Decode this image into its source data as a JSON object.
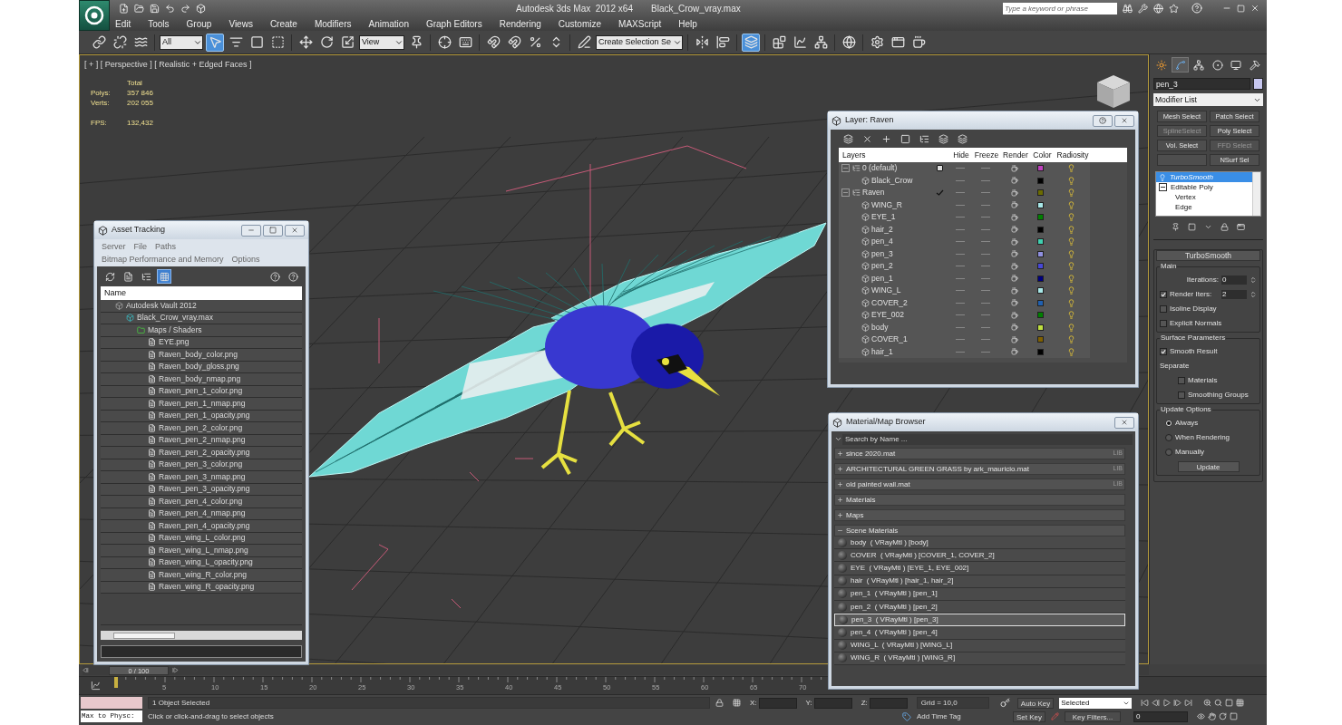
{
  "app": {
    "title": "Autodesk 3ds Max  2012 x64",
    "file": "Black_Crow_vray.max",
    "search": {
      "placeholder": "Type a keyword or phrase"
    }
  },
  "menu": [
    "Edit",
    "Tools",
    "Group",
    "Views",
    "Create",
    "Modifiers",
    "Animation",
    "Graph Editors",
    "Rendering",
    "Customize",
    "MAXScript",
    "Help"
  ],
  "toolbar": {
    "selection_filter": "All",
    "reference_coord": "View",
    "named_selection": "Create Selection Se",
    "buttons": [
      {
        "selected": false
      },
      {
        "selected": false
      },
      {
        "selected": false
      },
      {
        "selected": true
      },
      {
        "selected": false
      },
      {
        "selected": false
      },
      {
        "selected": false
      },
      {
        "selected": false
      },
      {
        "selected": false
      },
      {
        "selected": false
      },
      {
        "selected": false
      },
      {
        "selected": false
      },
      {
        "selected": false
      },
      {
        "selected": false
      },
      {
        "selected": false
      },
      {
        "selected": false
      },
      {
        "selected": false
      },
      {
        "selected": false
      },
      {
        "selected": false
      },
      {
        "selected": false
      },
      {
        "selected": true
      },
      {
        "selected": false
      },
      {
        "selected": false
      },
      {
        "selected": false
      },
      {
        "selected": false
      },
      {
        "selected": false
      },
      {
        "selected": false
      },
      {
        "selected": false
      }
    ]
  },
  "viewport": {
    "label": "[ + ] [ Perspective ] [ Realistic + Edged Faces ]",
    "stats_heading": "Total",
    "stats": [
      {
        "label": "Polys:",
        "value": "357 846"
      },
      {
        "label": "Verts:",
        "value": "202 055"
      }
    ],
    "fps": {
      "label": "FPS:",
      "value": "132,432"
    }
  },
  "asset_tracking": {
    "title": "Asset Tracking",
    "menu": [
      "Server",
      "File",
      "Paths",
      "Bitmap Performance and Memory",
      "Options"
    ],
    "tools": [
      {
        "selected": false
      },
      {
        "selected": false
      },
      {
        "selected": false
      },
      {
        "selected": true
      },
      {
        "selected": false
      },
      {
        "selected": false
      }
    ],
    "column": "Name",
    "tree": [
      {
        "kind": "vault",
        "name": "Autodesk Vault 2012",
        "children": [
          {
            "kind": "scene",
            "name": "Black_Crow_vray.max",
            "children": [
              {
                "kind": "folder",
                "name": "Maps / Shaders",
                "children": [
                  {
                    "kind": "bitmap",
                    "name": "EYE.png"
                  },
                  {
                    "kind": "bitmap",
                    "name": "Raven_body_color.png"
                  },
                  {
                    "kind": "bitmap",
                    "name": "Raven_body_gloss.png"
                  },
                  {
                    "kind": "bitmap",
                    "name": "Raven_body_nmap.png"
                  },
                  {
                    "kind": "bitmap",
                    "name": "Raven_pen_1_color.png"
                  },
                  {
                    "kind": "bitmap",
                    "name": "Raven_pen_1_nmap.png"
                  },
                  {
                    "kind": "bitmap",
                    "name": "Raven_pen_1_opacity.png"
                  },
                  {
                    "kind": "bitmap",
                    "name": "Raven_pen_2_color.png"
                  },
                  {
                    "kind": "bitmap",
                    "name": "Raven_pen_2_nmap.png"
                  },
                  {
                    "kind": "bitmap",
                    "name": "Raven_pen_2_opacity.png"
                  },
                  {
                    "kind": "bitmap",
                    "name": "Raven_pen_3_color.png"
                  },
                  {
                    "kind": "bitmap",
                    "name": "Raven_pen_3_nmap.png"
                  },
                  {
                    "kind": "bitmap",
                    "name": "Raven_pen_3_opacity.png"
                  },
                  {
                    "kind": "bitmap",
                    "name": "Raven_pen_4_color.png"
                  },
                  {
                    "kind": "bitmap",
                    "name": "Raven_pen_4_nmap.png"
                  },
                  {
                    "kind": "bitmap",
                    "name": "Raven_pen_4_opacity.png"
                  },
                  {
                    "kind": "bitmap",
                    "name": "Raven_wing_L_color.png"
                  },
                  {
                    "kind": "bitmap",
                    "name": "Raven_wing_L_nmap.png"
                  },
                  {
                    "kind": "bitmap",
                    "name": "Raven_wing_L_opacity.png"
                  },
                  {
                    "kind": "bitmap",
                    "name": "Raven_wing_R_color.png"
                  },
                  {
                    "kind": "bitmap",
                    "name": "Raven_wing_R_opacity.png"
                  }
                ]
              }
            ]
          }
        ]
      }
    ]
  },
  "layer_window": {
    "title": "Layer: Raven",
    "columns": [
      "Layers",
      "Hide",
      "Freeze",
      "Render",
      "Color",
      "Radiosity"
    ],
    "layers": [
      {
        "name": "0 (default)",
        "expanded": true,
        "current": false,
        "color": "#c040c0",
        "children": [
          {
            "name": "Black_Crow",
            "color": "#000000"
          }
        ]
      },
      {
        "name": "Raven",
        "expanded": true,
        "current": true,
        "color": "#6b6b00",
        "children": [
          {
            "name": "WING_R",
            "color": "#a8e8e8"
          },
          {
            "name": "EYE_1",
            "color": "#008000"
          },
          {
            "name": "hair_2",
            "color": "#000000"
          },
          {
            "name": "pen_4",
            "color": "#40d0b0"
          },
          {
            "name": "pen_3",
            "color": "#9090e0"
          },
          {
            "name": "pen_2",
            "color": "#4848d8"
          },
          {
            "name": "pen_1",
            "color": "#000080"
          },
          {
            "name": "WING_L",
            "color": "#a8e8e8"
          },
          {
            "name": "COVER_2",
            "color": "#2060b0"
          },
          {
            "name": "EYE_002",
            "color": "#008000"
          },
          {
            "name": "body",
            "color": "#c0e040"
          },
          {
            "name": "COVER_1",
            "color": "#806000"
          },
          {
            "name": "hair_1",
            "color": "#000000"
          }
        ]
      }
    ]
  },
  "material_browser": {
    "title": "Material/Map Browser",
    "search": {
      "placeholder": "Search by Name ..."
    },
    "groups": [
      {
        "name": "since 2020.mat",
        "expanded": false,
        "badge": "LIB"
      },
      {
        "name": "ARCHITECTURAL GREEN GRASS by ark_mauricio.mat",
        "expanded": false,
        "badge": "LIB"
      },
      {
        "name": "old painted wall.mat",
        "expanded": false,
        "badge": "LIB"
      },
      {
        "name": "Materials",
        "expanded": false
      },
      {
        "name": "Maps",
        "expanded": false
      },
      {
        "name": "Scene Materials",
        "expanded": true,
        "items": [
          {
            "name": "body  ( VRayMtl ) [body]",
            "selected": false
          },
          {
            "name": "COVER  ( VRayMtl ) [COVER_1, COVER_2]",
            "selected": false
          },
          {
            "name": "EYE  ( VRayMtl ) [EYE_1, EYE_002]",
            "selected": false
          },
          {
            "name": "hair  ( VRayMtl ) [hair_1, hair_2]",
            "selected": false
          },
          {
            "name": "pen_1  ( VRayMtl ) [pen_1]",
            "selected": false
          },
          {
            "name": "pen_2  ( VRayMtl ) [pen_2]",
            "selected": false
          },
          {
            "name": "pen_3  ( VRayMtl ) [pen_3]",
            "selected": true
          },
          {
            "name": "pen_4  ( VRayMtl ) [pen_4]",
            "selected": false
          },
          {
            "name": "WING_L  ( VRayMtl ) [WING_L]",
            "selected": false
          },
          {
            "name": "WING_R  ( VRayMtl ) [WING_R]",
            "selected": false
          }
        ]
      }
    ]
  },
  "command_panel": {
    "tabs": [
      {
        "selected": false
      },
      {
        "selected": true
      },
      {
        "selected": false
      },
      {
        "selected": false
      },
      {
        "selected": false
      },
      {
        "selected": false
      }
    ],
    "object_name": "pen_3",
    "modifier_list": "Modifier List",
    "modifier_buttons": [
      {
        "kind": "button",
        "label": "Mesh Select",
        "disabled": false
      },
      {
        "kind": "button",
        "label": "Patch Select",
        "disabled": false
      },
      {
        "kind": "button",
        "label": "SplineSelect",
        "disabled": true
      },
      {
        "kind": "button",
        "label": "Poly Select",
        "disabled": false
      },
      {
        "kind": "button",
        "label": "Vol. Select",
        "disabled": false
      },
      {
        "kind": "button",
        "label": "FFD Select",
        "disabled": true
      },
      {
        "kind": "blank"
      },
      {
        "kind": "button",
        "label": "NSurf Sel",
        "disabled": false
      }
    ],
    "stack": [
      {
        "name": "TurboSmooth",
        "selected": true
      },
      {
        "name": "Editable Poly",
        "selected": false,
        "expanded": true,
        "children": [
          {
            "name": "Vertex"
          },
          {
            "name": "Edge"
          }
        ]
      }
    ],
    "rollout": {
      "title": "TurboSmooth",
      "groups": [
        {
          "title": "Main",
          "controls": [
            {
              "kind": "spinner",
              "label": "Iterations:",
              "value": "0"
            },
            {
              "kind": "check_spinner",
              "label": "Render Iters:",
              "checked": true,
              "value": "2"
            },
            {
              "kind": "checkbox",
              "label": "Isoline Display",
              "checked": false
            },
            {
              "kind": "checkbox",
              "label": "Explicit Normals",
              "checked": false
            }
          ]
        },
        {
          "title": "Surface Parameters",
          "controls": [
            {
              "kind": "checkbox",
              "label": "Smooth Result",
              "checked": true
            },
            {
              "kind": "label",
              "label": "Separate"
            },
            {
              "kind": "sub_checkbox",
              "label": "Materials",
              "checked": false
            },
            {
              "kind": "sub_checkbox",
              "label": "Smoothing Groups",
              "checked": false
            }
          ]
        },
        {
          "title": "Update Options",
          "controls": [
            {
              "kind": "radio",
              "label": "Always",
              "selected": true
            },
            {
              "kind": "radio",
              "label": "When Rendering",
              "selected": false
            },
            {
              "kind": "radio",
              "label": "Manually",
              "selected": false
            },
            {
              "kind": "button",
              "label": "Update"
            }
          ]
        }
      ]
    }
  },
  "timeline": {
    "position": "0 / 100",
    "level": 0,
    "ticks": [
      "5",
      "10",
      "15",
      "20",
      "25",
      "30",
      "35",
      "40",
      "45",
      "50",
      "55",
      "60",
      "65",
      "70"
    ]
  },
  "status": {
    "script_field": "Max to Physc:",
    "selection": "1 Object Selected",
    "prompt": "Click or click-and-drag to select objects",
    "coords": [
      "X:",
      "Y:",
      "Z:"
    ],
    "grid": "Grid = 10,0",
    "time_tag": "Add Time Tag",
    "auto_key": "Auto Key",
    "key_mode": "Selected",
    "set_key": "Set Key",
    "key_filters": "Key Filters...",
    "frame": "0"
  }
}
